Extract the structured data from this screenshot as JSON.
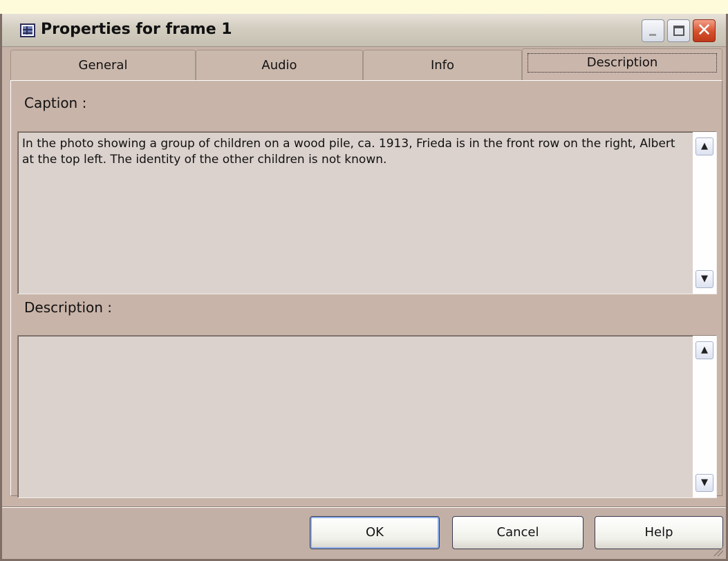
{
  "window": {
    "title": "Properties for frame 1",
    "icon": "properties-table-icon",
    "controls": {
      "minimize": "_",
      "maximize": "□",
      "close": "✕"
    }
  },
  "tabs": [
    {
      "label": "General",
      "active": false
    },
    {
      "label": "Audio",
      "active": false
    },
    {
      "label": "Info",
      "active": false
    },
    {
      "label": "Description",
      "active": true
    }
  ],
  "caption": {
    "label": "Caption :",
    "value": "In the photo showing a group of children on a wood pile, ca. 1913, Frieda is in the front row on the right, Albert at the top left.  The identity of the other children is not known."
  },
  "description": {
    "label": "Description :",
    "value": ""
  },
  "scroll": {
    "up": "▲",
    "down": "▼"
  },
  "buttons": {
    "ok": "OK",
    "cancel": "Cancel",
    "help": "Help"
  },
  "colors": {
    "dialog_bg": "#c8b3a8",
    "textbox_bg": "#dbd2cd",
    "page_bg": "#fdfbd9",
    "close_button": "#d5502c"
  }
}
